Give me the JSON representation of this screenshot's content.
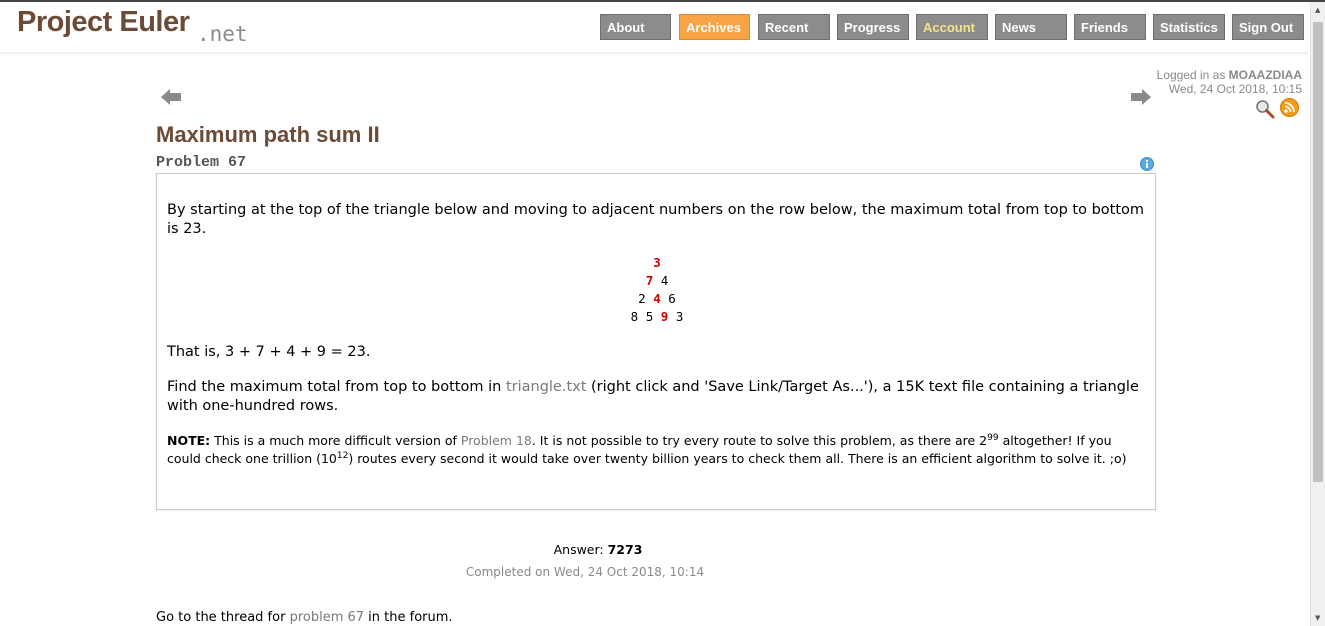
{
  "logo": {
    "main": "Project Euler",
    "suffix": ".net"
  },
  "nav": [
    {
      "label": "About",
      "style": "gray"
    },
    {
      "label": "Archives",
      "style": "orange"
    },
    {
      "label": "Recent",
      "style": "gray"
    },
    {
      "label": "Progress",
      "style": "gray"
    },
    {
      "label": "Account",
      "style": "olive"
    },
    {
      "label": "News",
      "style": "gray"
    },
    {
      "label": "Friends",
      "style": "gray"
    },
    {
      "label": "Statistics",
      "style": "gray"
    },
    {
      "label": "Sign Out",
      "style": "gray"
    }
  ],
  "user": {
    "logged_in_prefix": "Logged in as",
    "username": "MOAAZDIAA",
    "datetime": "Wed, 24 Oct 2018, 10:15"
  },
  "problem": {
    "title": "Maximum path sum II",
    "number_label": "Problem 67",
    "intro": "By starting at the top of the triangle below and moving to adjacent numbers on the row below, the maximum total from top to bottom is 23.",
    "triangle": [
      [
        "3"
      ],
      [
        "7",
        "4"
      ],
      [
        "2",
        "4",
        "6"
      ],
      [
        "8",
        "5",
        "9",
        "3"
      ]
    ],
    "that_is": "That is, 3 + 7 + 4 + 9 = 23.",
    "find_pre": "Find the maximum total from top to bottom in ",
    "find_link": "triangle.txt",
    "find_post": " (right click and 'Save Link/Target As...'), a 15K text file containing a triangle with one-hundred rows.",
    "note_label": "NOTE:",
    "note_pre": " This is a much more difficult version of ",
    "note_link": "Problem 18",
    "note_mid": ". It is not possible to try every route to solve this problem, as there are 2",
    "note_sup1": "99",
    "note_mid2": " altogether! If you could check one trillion (10",
    "note_sup2": "12",
    "note_post": ") routes every second it would take over twenty billion years to check them all. There is an efficient algorithm to solve it. ;o)"
  },
  "answer": {
    "label": "Answer:",
    "value": "7273",
    "completed": "Completed on Wed, 24 Oct 2018, 10:14"
  },
  "forum": {
    "pre": "Go to the thread for ",
    "link": "problem 67",
    "post": " in the forum."
  },
  "colors": {
    "brand": "#6b4a36",
    "nav_gray": "#8c8c8c",
    "nav_orange": "#f7a346",
    "highlight_red": "#d00000",
    "link_gray": "#7a7a7a"
  },
  "icons": [
    "arrow-left-icon",
    "arrow-right-icon",
    "search-icon",
    "rss-icon",
    "info-icon"
  ]
}
